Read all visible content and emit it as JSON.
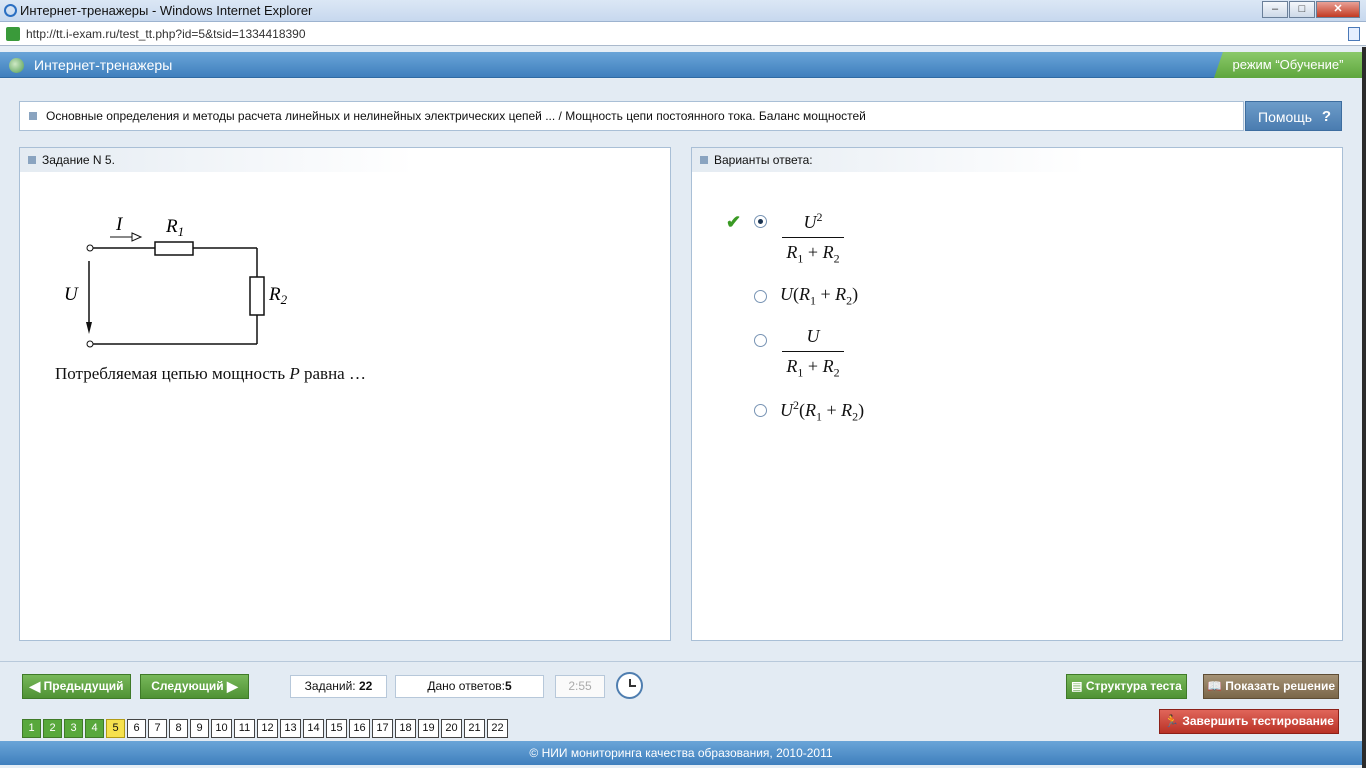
{
  "window": {
    "title": "Интернет-тренажеры - Windows Internet Explorer"
  },
  "address": {
    "url": "http://tt.i-exam.ru/test_tt.php?id=5&tsid=1334418390"
  },
  "header": {
    "app_name": "Интернет-тренажеры",
    "mode": "режим “Обучение”"
  },
  "breadcrumb": {
    "text": "Основные определения и методы расчета линейных и нелинейных электрических цепей ... / Мощность цепи постоянного тока. Баланс мощностей",
    "help_label": "Помощь",
    "help_icon": "?"
  },
  "task": {
    "title": "Задание N 5.",
    "question": "Потребляемая цепью мощность",
    "question_var": "P",
    "question_tail": "равна …",
    "circuit": {
      "current": "I",
      "voltage": "U",
      "r1": "R",
      "r1_sub": "1",
      "r2": "R",
      "r2_sub": "2"
    }
  },
  "answers": {
    "title": "Варианты ответа:",
    "selected_index": 0,
    "correct_index": 0,
    "options": [
      {
        "u": "U",
        "pow": "2",
        "r1": "R",
        "s1": "1",
        "plus": "+",
        "r2": "R",
        "s2": "2"
      },
      {
        "u": "U",
        "r1": "R",
        "s1": "1",
        "plus": "+",
        "r2": "R",
        "s2": "2"
      },
      {
        "u": "U",
        "r1": "R",
        "s1": "1",
        "plus": "+",
        "r2": "R",
        "s2": "2"
      },
      {
        "u": "U",
        "pow": "2",
        "r1": "R",
        "s1": "1",
        "plus": "+",
        "r2": "R",
        "s2": "2"
      }
    ]
  },
  "nav": {
    "prev_label": "Предыдущий",
    "next_label": "Следующий",
    "tasks_label": "Заданий:",
    "tasks_count": "22",
    "answered_label": "Дано ответов:",
    "answered_count": "5",
    "timer": "2:55",
    "structure_label": "Структура теста",
    "solution_label": "Показать решение",
    "finish_label": "Завершить тестирование"
  },
  "pages": [
    "1",
    "2",
    "3",
    "4",
    "5",
    "6",
    "7",
    "8",
    "9",
    "10",
    "11",
    "12",
    "13",
    "14",
    "15",
    "16",
    "17",
    "18",
    "19",
    "20",
    "21",
    "22"
  ],
  "pages_done": 4,
  "pages_current": 5,
  "footer": {
    "text": "© НИИ мониторинга качества образования, 2010-2011"
  }
}
